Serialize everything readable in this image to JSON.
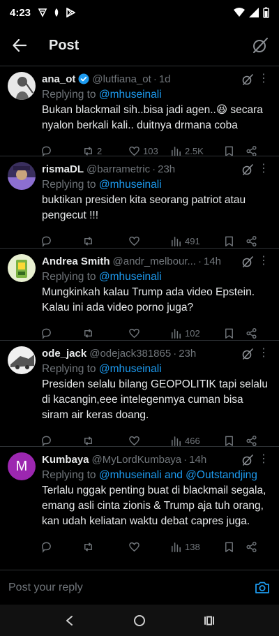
{
  "status": {
    "time": "4:23"
  },
  "header": {
    "title": "Post"
  },
  "posts": [
    {
      "name": "ana_ot",
      "handle": "@lutfiana_ot",
      "time": "1d",
      "verified": true,
      "replying_prefix": "Replying to",
      "replying_to": "@mhuseinali",
      "text": "Bukan blackmail sih..bisa jadi agen..😆 secara nyalon berkali kali.. duitnya drmana coba",
      "retweets": "2",
      "likes": "103",
      "views": "2.5K",
      "avatar_color": "#dcdcdc"
    },
    {
      "name": "rismaDL",
      "handle": "@barrametric",
      "time": "23h",
      "verified": false,
      "replying_prefix": "Replying to",
      "replying_to": "@mhuseinali",
      "text": "buktikan presiden kita seorang patriot atau pengecut !!!",
      "retweets": "",
      "likes": "",
      "views": "491",
      "avatar_color": "#5b4a8c"
    },
    {
      "name": "Andrea Smith",
      "handle": "@andr_melbour...",
      "time": "14h",
      "verified": false,
      "replying_prefix": "Replying to",
      "replying_to": "@mhuseinali",
      "text": "Mungkinkah kalau Trump ada video Epstein. Kalau ini ada video porno juga?",
      "retweets": "",
      "likes": "",
      "views": "102",
      "avatar_color": "#8bbf3a"
    },
    {
      "name": "ode_jack",
      "handle": "@odejack381865",
      "time": "23h",
      "verified": false,
      "replying_prefix": "Replying to",
      "replying_to": "@mhuseinali",
      "text": "Presiden selalu bilang GEOPOLITIK tapi selalu di kacangin,eee intelegenmya cuman bisa siram air keras doang.",
      "retweets": "",
      "likes": "",
      "views": "466",
      "avatar_color": "#9a9a9a"
    },
    {
      "name": "Kumbaya",
      "handle": "@MyLordKumbaya",
      "time": "14h",
      "verified": false,
      "replying_prefix": "Replying to",
      "replying_to": "@mhuseinali and @Outstandjing",
      "text": "Terlalu nggak penting buat di blackmail segala, emang asli cinta zionis & Trump aja tuh orang,  kan udah keliatan waktu debat capres juga.",
      "retweets": "",
      "likes": "",
      "views": "138",
      "avatar_color": "#9c27b0",
      "avatar_letter": "M"
    }
  ],
  "reply_bar": {
    "placeholder": "Post your reply"
  },
  "colors": {
    "accent": "#1d9bf0",
    "muted": "#71767b",
    "background": "#000000"
  }
}
